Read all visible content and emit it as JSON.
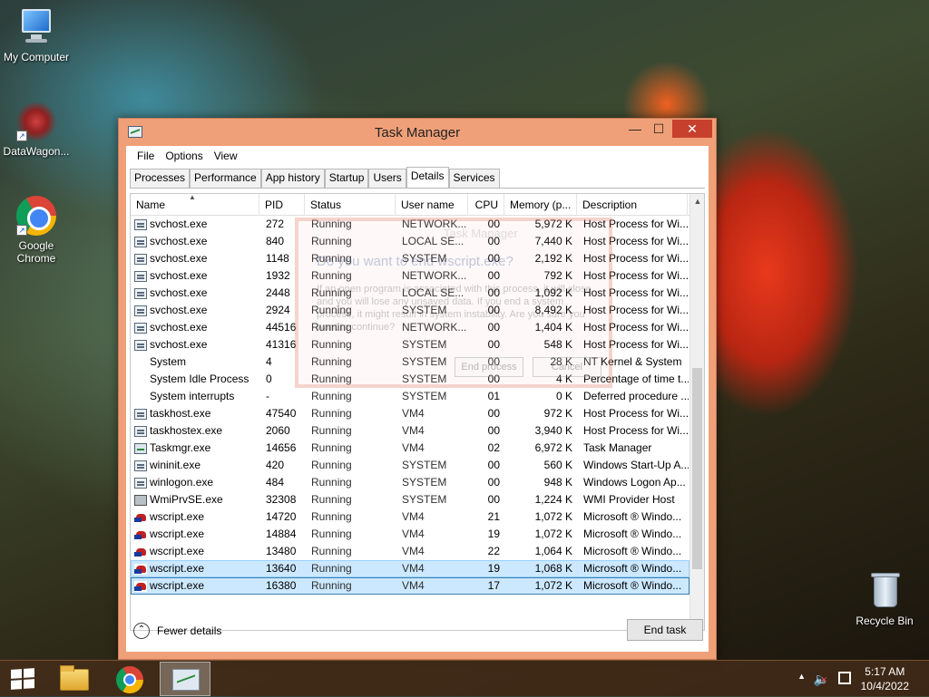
{
  "desktop": {
    "icons": [
      {
        "label": "My Computer"
      },
      {
        "label": "DataWagon..."
      },
      {
        "label": "Google Chrome"
      },
      {
        "label": "Recycle Bin"
      }
    ]
  },
  "window": {
    "title": "Task Manager",
    "controls": {
      "minimize": "—",
      "maximize": "☐",
      "close": "✕"
    },
    "menu": [
      "File",
      "Options",
      "View"
    ],
    "tabs": [
      "Processes",
      "Performance",
      "App history",
      "Startup",
      "Users",
      "Details",
      "Services"
    ],
    "active_tab": "Details",
    "columns": {
      "name": "Name",
      "pid": "PID",
      "status": "Status",
      "user": "User name",
      "cpu": "CPU",
      "memory": "Memory (p...",
      "description": "Description"
    },
    "rows": [
      {
        "icon": "svchost",
        "name": "svchost.exe",
        "pid": "272",
        "status": "Running",
        "user": "NETWORK...",
        "cpu": "00",
        "mem": "5,972 K",
        "desc": "Host Process for Wi..."
      },
      {
        "icon": "svchost",
        "name": "svchost.exe",
        "pid": "840",
        "status": "Running",
        "user": "LOCAL SE...",
        "cpu": "00",
        "mem": "7,440 K",
        "desc": "Host Process for Wi..."
      },
      {
        "icon": "svchost",
        "name": "svchost.exe",
        "pid": "1148",
        "status": "Running",
        "user": "SYSTEM",
        "cpu": "00",
        "mem": "2,192 K",
        "desc": "Host Process for Wi..."
      },
      {
        "icon": "svchost",
        "name": "svchost.exe",
        "pid": "1932",
        "status": "Running",
        "user": "NETWORK...",
        "cpu": "00",
        "mem": "792 K",
        "desc": "Host Process for Wi..."
      },
      {
        "icon": "svchost",
        "name": "svchost.exe",
        "pid": "2448",
        "status": "Running",
        "user": "LOCAL SE...",
        "cpu": "00",
        "mem": "1,092 K",
        "desc": "Host Process for Wi..."
      },
      {
        "icon": "svchost",
        "name": "svchost.exe",
        "pid": "2924",
        "status": "Running",
        "user": "SYSTEM",
        "cpu": "00",
        "mem": "8,492 K",
        "desc": "Host Process for Wi..."
      },
      {
        "icon": "svchost",
        "name": "svchost.exe",
        "pid": "44516",
        "status": "Running",
        "user": "NETWORK...",
        "cpu": "00",
        "mem": "1,404 K",
        "desc": "Host Process for Wi..."
      },
      {
        "icon": "svchost",
        "name": "svchost.exe",
        "pid": "41316",
        "status": "Running",
        "user": "SYSTEM",
        "cpu": "00",
        "mem": "548 K",
        "desc": "Host Process for Wi..."
      },
      {
        "icon": "blank",
        "name": "System",
        "pid": "4",
        "status": "Running",
        "user": "SYSTEM",
        "cpu": "00",
        "mem": "28 K",
        "desc": "NT Kernel & System"
      },
      {
        "icon": "blank",
        "name": "System Idle Process",
        "pid": "0",
        "status": "Running",
        "user": "SYSTEM",
        "cpu": "00",
        "mem": "4 K",
        "desc": "Percentage of time t..."
      },
      {
        "icon": "blank",
        "name": "System interrupts",
        "pid": "-",
        "status": "Running",
        "user": "SYSTEM",
        "cpu": "01",
        "mem": "0 K",
        "desc": "Deferred procedure ..."
      },
      {
        "icon": "svchost",
        "name": "taskhost.exe",
        "pid": "47540",
        "status": "Running",
        "user": "VM4",
        "cpu": "00",
        "mem": "972 K",
        "desc": "Host Process for Wi..."
      },
      {
        "icon": "svchost",
        "name": "taskhostex.exe",
        "pid": "2060",
        "status": "Running",
        "user": "VM4",
        "cpu": "00",
        "mem": "3,940 K",
        "desc": "Host Process for Wi..."
      },
      {
        "icon": "taskmgr",
        "name": "Taskmgr.exe",
        "pid": "14656",
        "status": "Running",
        "user": "VM4",
        "cpu": "02",
        "mem": "6,972 K",
        "desc": "Task Manager"
      },
      {
        "icon": "svchost",
        "name": "wininit.exe",
        "pid": "420",
        "status": "Running",
        "user": "SYSTEM",
        "cpu": "00",
        "mem": "560 K",
        "desc": "Windows Start-Up A..."
      },
      {
        "icon": "svchost",
        "name": "winlogon.exe",
        "pid": "484",
        "status": "Running",
        "user": "SYSTEM",
        "cpu": "00",
        "mem": "948 K",
        "desc": "Windows Logon Ap..."
      },
      {
        "icon": "wmi",
        "name": "WmiPrvSE.exe",
        "pid": "32308",
        "status": "Running",
        "user": "SYSTEM",
        "cpu": "00",
        "mem": "1,224 K",
        "desc": "WMI Provider Host"
      },
      {
        "icon": "wscript",
        "name": "wscript.exe",
        "pid": "14720",
        "status": "Running",
        "user": "VM4",
        "cpu": "21",
        "mem": "1,072 K",
        "desc": "Microsoft ® Windo..."
      },
      {
        "icon": "wscript",
        "name": "wscript.exe",
        "pid": "14884",
        "status": "Running",
        "user": "VM4",
        "cpu": "19",
        "mem": "1,072 K",
        "desc": "Microsoft ® Windo..."
      },
      {
        "icon": "wscript",
        "name": "wscript.exe",
        "pid": "13480",
        "status": "Running",
        "user": "VM4",
        "cpu": "22",
        "mem": "1,064 K",
        "desc": "Microsoft ® Windo..."
      },
      {
        "icon": "wscript",
        "name": "wscript.exe",
        "pid": "13640",
        "status": "Running",
        "user": "VM4",
        "cpu": "19",
        "mem": "1,068 K",
        "desc": "Microsoft ® Windo...",
        "state": "selected"
      },
      {
        "icon": "wscript",
        "name": "wscript.exe",
        "pid": "16380",
        "status": "Running",
        "user": "VM4",
        "cpu": "17",
        "mem": "1,072 K",
        "desc": "Microsoft ® Windo...",
        "state": "selected-focus"
      }
    ],
    "fewer_details": "Fewer details",
    "end_task": "End task",
    "ghost_dialog": {
      "title": "Task Manager",
      "question": "Do you want to end wscript.exe?",
      "message": "If an open program is associated with this process, it will close and you will lose any unsaved data. If you end a system process, it might result in system instability. Are you sure you want to continue?",
      "end_button": "End process",
      "cancel_button": "Cancel"
    }
  },
  "taskbar": {
    "clock_time": "5:17 AM",
    "clock_date": "10/4/2022"
  }
}
